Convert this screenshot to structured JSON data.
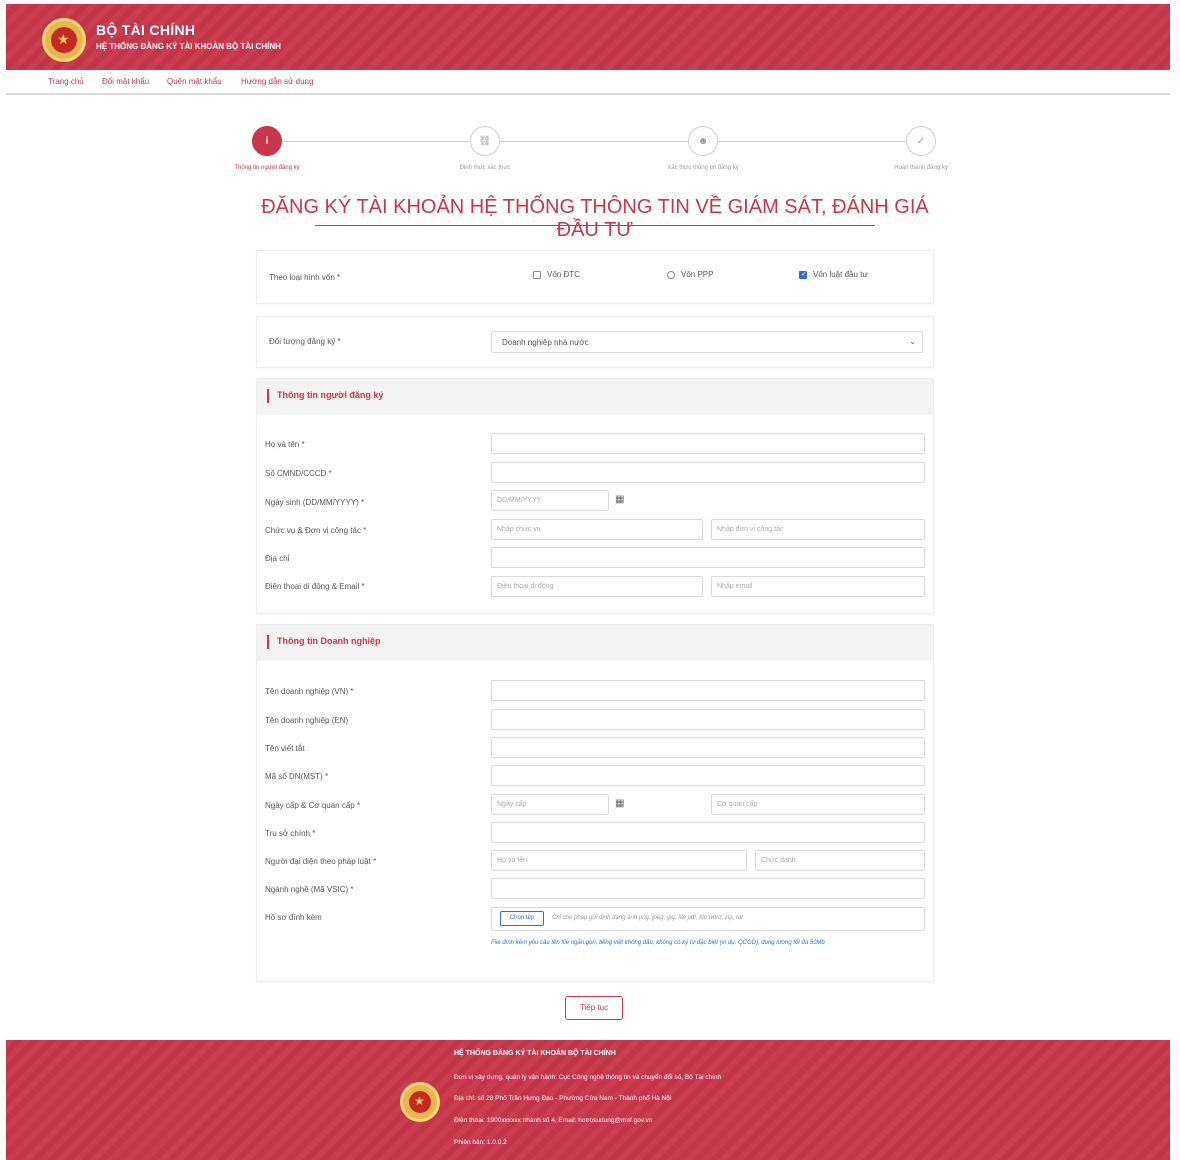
{
  "header": {
    "title": "BỘ TÀI CHÍNH",
    "subtitle": "HỆ THỐNG ĐĂNG KÝ TÀI KHOẢN BỘ TÀI CHÍNH"
  },
  "nav": [
    "Trang chủ",
    "Đổi mật khẩu",
    "Quên mật khẩu",
    "Hướng dẫn sử dụng"
  ],
  "steps": [
    {
      "label": "Thông tin người đăng ký",
      "icon": "info-icon",
      "glyph": "i"
    },
    {
      "label": "Định thức xác thực",
      "icon": "network-icon",
      "glyph": "⛓"
    },
    {
      "label": "Xác thực thông tin đăng ký",
      "icon": "user-check-icon",
      "glyph": "☻"
    },
    {
      "label": "Hoàn thành đăng ký",
      "icon": "check-circle-icon",
      "glyph": "✓"
    }
  ],
  "page_title": "ĐĂNG KÝ TÀI KHOẢN HỆ THỐNG THÔNG TIN VỀ GIÁM SÁT, ĐÁNH GIÁ ĐẦU TƯ",
  "capital_type": {
    "label": "Theo loại hình vốn *",
    "options": [
      {
        "label": "Vốn ĐTC",
        "checked": false
      },
      {
        "label": "Vốn PPP",
        "checked": false
      },
      {
        "label": "Vốn luật đầu tư",
        "checked": true
      }
    ]
  },
  "registrant_type": {
    "label": "Đối tượng đăng ký *",
    "value": "Doanh nghiệp nhà nước"
  },
  "registrant_section": {
    "title": "Thông tin người đăng ký",
    "fields": {
      "full_name": "Họ và tên *",
      "id_number": "Số CMND/CCCD *",
      "dob": "Ngày sinh (DD/MM/YYYY) *",
      "dob_placeholder": "DD/MM/YYYY",
      "position_unit": "Chức vụ & Đơn vị công tác *",
      "position_placeholder": "Nhập chức vụ",
      "unit_placeholder": "Nhập đơn vị công tác",
      "address": "Địa chỉ",
      "phone_email": "Điện thoại di động & Email *",
      "phone_placeholder": "Điện thoại di động",
      "email_placeholder": "Nhập email"
    }
  },
  "company_section": {
    "title": "Thông tin Doanh nghiệp",
    "fields": {
      "name_vn": "Tên doanh nghiệp (VN) *",
      "name_en": "Tên doanh nghiệp (EN)",
      "short_name": "Tên viết tắt",
      "tax_code": "Mã số DN(MST) *",
      "issue_date_agency": "Ngày cấp & Cơ quan cấp *",
      "issue_date_placeholder": "Ngày cấp",
      "agency_placeholder": "Cơ quan cấp",
      "headquarters": "Trụ sở chính *",
      "legal_rep": "Người đại diện theo pháp luật *",
      "legal_rep_name_placeholder": "Họ và tên",
      "legal_rep_title_placeholder": "Chức danh",
      "industry": "Ngành nghề (Mã VSIC) *",
      "attachments": "Hồ sơ đính kèm",
      "choose_file": "Chọn tệp",
      "file_hint": "Chỉ cho phép gửi định dạng ảnh png, jpeg, jpg, file pdf, file word, zip, rar",
      "note": "File đính kèm yêu cầu tên file ngắn gọn, tiếng việt không dấu, không có ký tự đặc biệt (ví dụ: QCGD), dung lượng tối đa 50Mb"
    }
  },
  "next_button": "Tiếp tục",
  "footer": {
    "title": "HỆ THỐNG ĐĂNG KÝ TÀI KHOẢN BỘ TÀI CHÍNH",
    "line1": "Đơn vị xây dựng, quản lý vận hành: Cục Công nghệ thông tin và chuyển đổi số, Bộ Tài chính",
    "line2": "Địa chỉ: số 28 Phố Trần Hưng Đạo - Phường Cửa Nam - Thành phố Hà Nội",
    "line3": "Điện thoại: 1900xxxxxx nhánh số 4, Email: hotrosudung@mof.gov.vn",
    "version": "Phiên bản: 1.0.0.2"
  }
}
